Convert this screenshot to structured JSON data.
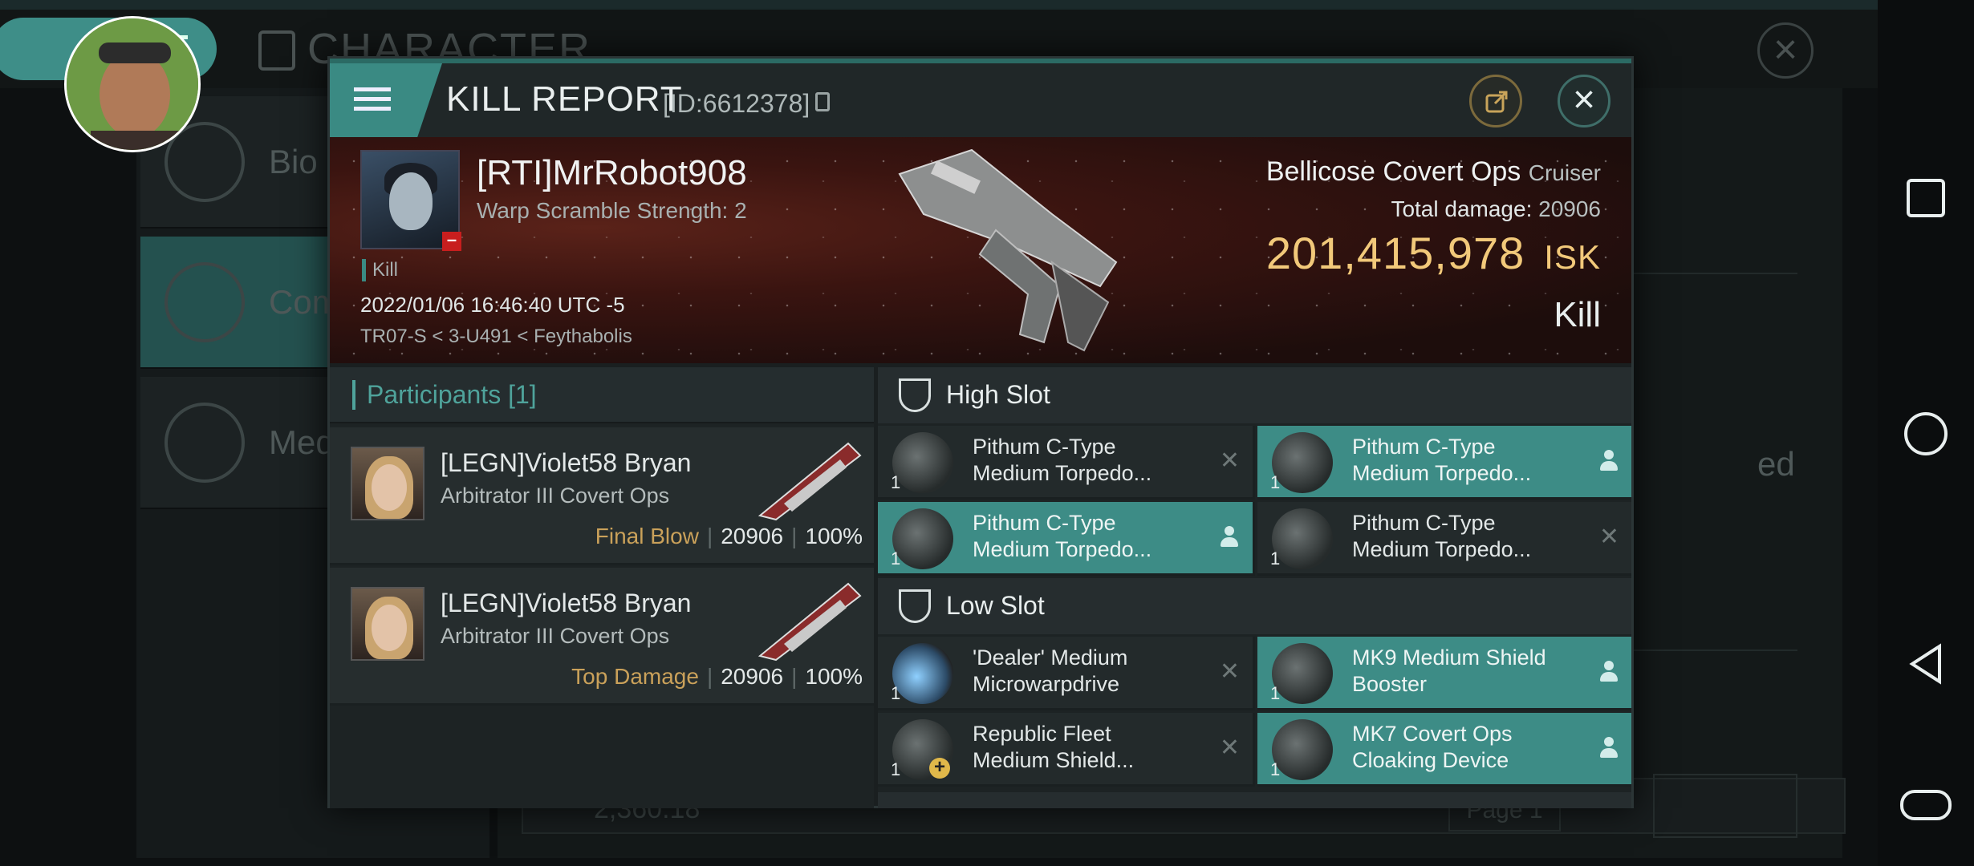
{
  "background": {
    "title": "CHARACTER",
    "sidebar": [
      {
        "label": "Bio",
        "icon": "menu-icon"
      },
      {
        "label": "Com",
        "icon": "swords-icon"
      },
      {
        "label": "Med",
        "icon": "star-icon"
      }
    ],
    "right_text": "ed",
    "bottom_value": "2,360.18",
    "page_label": "Page 1"
  },
  "modal": {
    "title": "KILL REPORT",
    "id_text": "[ID:6612378]",
    "victim": {
      "name": "[RTI]MrRobot908",
      "warp": "Warp Scramble Strength: 2",
      "tag": "Kill",
      "datetime": "2022/01/06 16:46:40 UTC -5",
      "location": "TR07-S < 3-U491 < Feythabolis"
    },
    "ship": {
      "name": "Bellicose Covert Ops",
      "class": "Cruiser",
      "total_damage_label": "Total damage:",
      "total_damage": "20906",
      "isk_value": "201,415,978",
      "isk_unit": "ISK",
      "result": "Kill"
    },
    "participants": {
      "label": "Participants",
      "count": "[1]",
      "rows": [
        {
          "name": "[LEGN]Violet58 Bryan",
          "ship": "Arbitrator III Covert Ops",
          "role": "Final Blow",
          "damage": "20906",
          "percent": "100%"
        },
        {
          "name": "[LEGN]Violet58 Bryan",
          "ship": "Arbitrator III Covert Ops",
          "role": "Top Damage",
          "damage": "20906",
          "percent": "100%"
        }
      ]
    },
    "high_slot": {
      "label": "High Slot",
      "modules": [
        {
          "name1": "Pithum C-Type",
          "name2": "Medium Torpedo...",
          "qty": "1",
          "status": "destroyed"
        },
        {
          "name1": "Pithum C-Type",
          "name2": "Medium Torpedo...",
          "qty": "1",
          "status": "dropped"
        },
        {
          "name1": "Pithum C-Type",
          "name2": "Medium Torpedo...",
          "qty": "1",
          "status": "dropped"
        },
        {
          "name1": "Pithum C-Type",
          "name2": "Medium Torpedo...",
          "qty": "1",
          "status": "destroyed"
        }
      ]
    },
    "low_slot": {
      "label": "Low Slot",
      "modules": [
        {
          "name1": "'Dealer' Medium",
          "name2": "Microwarpdrive",
          "qty": "1",
          "status": "destroyed"
        },
        {
          "name1": "MK9 Medium Shield",
          "name2": "Booster",
          "qty": "1",
          "status": "dropped"
        },
        {
          "name1": "Republic Fleet",
          "name2": "Medium Shield...",
          "qty": "1",
          "status": "destroyed"
        },
        {
          "name1": "MK7 Covert Ops",
          "name2": "Cloaking Device",
          "qty": "1",
          "status": "dropped"
        }
      ]
    },
    "colors": {
      "accent": "#3d8c86",
      "isk": "#f2c97a",
      "role": "#caa15a"
    }
  }
}
